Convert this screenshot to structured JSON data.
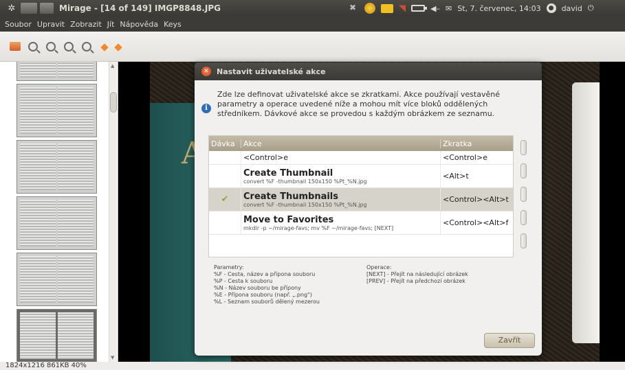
{
  "panel": {
    "window_title": "Mirage - [14 of 149] IMGP8848.JPG",
    "clock": "St, 7. červenec, 14:03",
    "user": "david"
  },
  "menu": [
    "Soubor",
    "Upravit",
    "Zobrazit",
    "Jít",
    "Nápověda",
    "Keys"
  ],
  "toolbar": {
    "icons": [
      "open-icon",
      "zoom-out-icon",
      "zoom-in-icon",
      "zoom-fit-icon",
      "zoom-100-icon",
      "prev-arrow-icon",
      "next-arrow-icon"
    ]
  },
  "statusbar": {
    "info": "1824x1216   861KB   40%"
  },
  "dialog": {
    "title": "Nastavit uživatelské akce",
    "description": "Zde lze definovat uživatelské akce se zkratkami. Akce používají vestavěné parametry a operace uvedené níže a mohou mít více bloků oddělených středníkem. Dávkové akce se provedou s každým obrázkem ze seznamu.",
    "columns": {
      "batch": "Dávka",
      "action": "Akce",
      "shortcut": "Zkratka"
    },
    "rows": [
      {
        "name": "<Control>e",
        "cmd": "",
        "shortcut": "<Control>e",
        "batch": false
      },
      {
        "name": "Create Thumbnail",
        "cmd": "convert %F -thumbnail 150x150 %Pt_%N.jpg",
        "shortcut": "<Alt>t",
        "batch": false
      },
      {
        "name": "Create Thumbnails",
        "cmd": "convert %F -thumbnail 150x150 %Pt_%N.jpg",
        "shortcut": "<Control><Alt>t",
        "batch": true
      },
      {
        "name": "Move to Favorites",
        "cmd": "mkdir -p ~/mirage-favs; mv %F ~/mirage-favs; [NEXT]",
        "shortcut": "<Control><Alt>f",
        "batch": false
      }
    ],
    "params_title": "Parametry:",
    "params": [
      "%F - Cesta, název a přípona souboru",
      "%P - Cesta k souboru",
      "%N - Název souboru be přípony",
      "%E - Přípona souboru (např. „.png\")",
      "%L - Seznam souborů dělený mezerou"
    ],
    "ops_title": "Operace:",
    "ops": [
      "[NEXT] - Přejít na následující obrázek",
      "[PREV] - Přejít na předchozí obrázek"
    ],
    "close_label": "Zavřít"
  },
  "photo": {
    "letter": "A"
  }
}
